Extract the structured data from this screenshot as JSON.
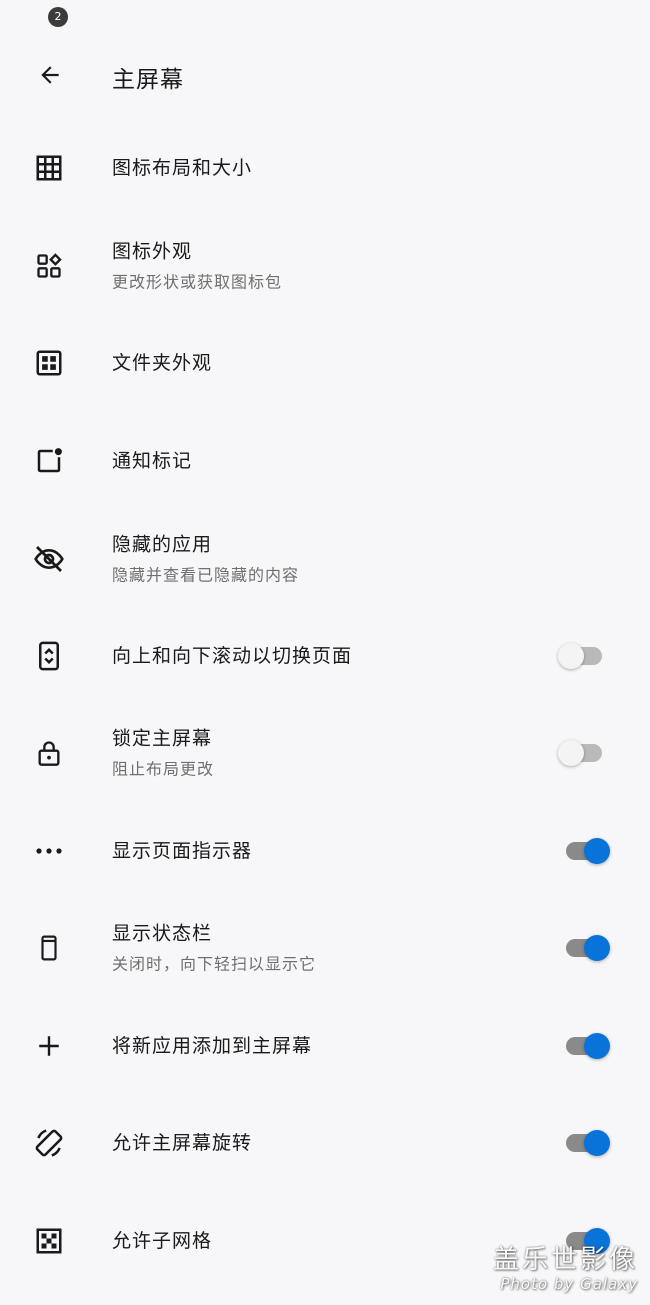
{
  "status_bar": {
    "notification_count": "2"
  },
  "header": {
    "title": "主屏幕",
    "back_icon": "arrow-left-icon"
  },
  "items": [
    {
      "label": "图标布局和大小",
      "sub": "",
      "icon": "grid-icon",
      "toggle": null
    },
    {
      "label": "图标外观",
      "sub": "更改形状或获取图标包",
      "icon": "shapes-icon",
      "toggle": null
    },
    {
      "label": "文件夹外观",
      "sub": "",
      "icon": "folder-grid-icon",
      "toggle": null
    },
    {
      "label": "通知标记",
      "sub": "",
      "icon": "notification-badge-icon",
      "toggle": null
    },
    {
      "label": "隐藏的应用",
      "sub": "隐藏并查看已隐藏的内容",
      "icon": "eye-off-icon",
      "toggle": null
    },
    {
      "label": "向上和向下滚动以切换页面",
      "sub": "",
      "icon": "vertical-scroll-icon",
      "toggle": false
    },
    {
      "label": "锁定主屏幕",
      "sub": "阻止布局更改",
      "icon": "lock-icon",
      "toggle": false
    },
    {
      "label": "显示页面指示器",
      "sub": "",
      "icon": "more-dots-icon",
      "toggle": true
    },
    {
      "label": "显示状态栏",
      "sub": "关闭时，向下轻扫以显示它",
      "icon": "phone-icon",
      "toggle": true
    },
    {
      "label": "将新应用添加到主屏幕",
      "sub": "",
      "icon": "plus-icon",
      "toggle": true
    },
    {
      "label": "允许主屏幕旋转",
      "sub": "",
      "icon": "screen-rotation-icon",
      "toggle": true
    },
    {
      "label": "允许子网格",
      "sub": "",
      "icon": "subgrid-icon",
      "toggle": true
    }
  ],
  "colors": {
    "accent": "#0a73d9",
    "background": "#f7f7f9",
    "toggle_off_track": "#b9b9b9",
    "toggle_on_track": "#8a8a8a"
  },
  "watermark": {
    "main": "盖乐世影像",
    "sub": "Photo by Galaxy"
  }
}
